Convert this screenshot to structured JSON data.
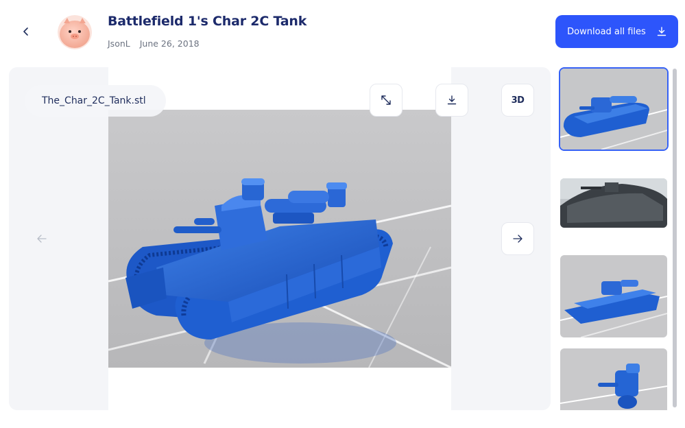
{
  "header": {
    "title": "Battlefield 1's Char 2C Tank",
    "author": "JsonL",
    "date": "June 26, 2018",
    "download_all_label": "Download all files"
  },
  "viewer": {
    "filename": "The_Char_2C_Tank.stl",
    "view_3d_label": "3D"
  },
  "icons": {
    "back": "chevron-left-icon",
    "expand": "expand-arrows-icon",
    "download": "download-icon",
    "prev": "arrow-left-icon",
    "next": "arrow-right-icon"
  },
  "thumbnails": [
    {
      "label": "tank render front",
      "active": true
    },
    {
      "label": "tank game screenshot",
      "active": false
    },
    {
      "label": "tank render side",
      "active": false
    },
    {
      "label": "turret render",
      "active": false
    }
  ],
  "colors": {
    "accent": "#2d55fb",
    "title": "#1c2a6b",
    "model_blue": "#1f5fd1"
  }
}
